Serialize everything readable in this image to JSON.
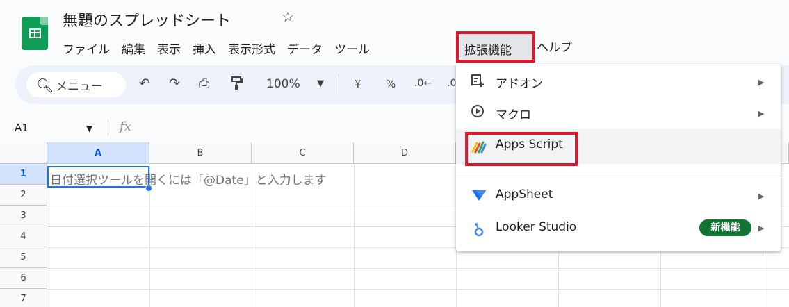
{
  "header": {
    "doc_title": "無題のスプレッドシート",
    "star": "☆"
  },
  "menubar": {
    "items": [
      "ファイル",
      "編集",
      "表示",
      "挿入",
      "表示形式",
      "データ",
      "ツール"
    ],
    "active": "拡張機能",
    "help": "ヘルプ"
  },
  "toolbar": {
    "search_label": "メニュー",
    "undo": "↶",
    "redo": "↷",
    "print": "⎙",
    "paint": "🖌",
    "zoom": "100%",
    "currency": "¥",
    "percent": "%",
    "decimal": ".0←",
    "decimal_more": ".0"
  },
  "formula_bar": {
    "name_box": "A1",
    "fx": "fx"
  },
  "grid": {
    "columns": [
      "A",
      "B",
      "C",
      "D"
    ],
    "rows": [
      "1",
      "2",
      "3",
      "4",
      "5",
      "6",
      "7"
    ],
    "cell_a1_hint": "日付選択ツールを開くには「@Date」と入力します"
  },
  "dropdown": {
    "items": [
      {
        "label": "アドオン",
        "icon": "addon-icon",
        "submenu": true
      },
      {
        "label": "マクロ",
        "icon": "macro-icon",
        "submenu": true
      },
      {
        "label": "Apps Script",
        "icon": "apps-script-icon",
        "submenu": false
      },
      {
        "label": "AppSheet",
        "icon": "appsheet-icon",
        "submenu": true
      },
      {
        "label": "Looker Studio",
        "icon": "looker-studio-icon",
        "submenu": true
      }
    ],
    "badge": "新機能",
    "arrow": "▶"
  },
  "colors": {
    "highlight_red": "#e0182d",
    "sheets_green": "#0f9d58",
    "selection_blue": "#1a73e8",
    "badge_green": "#137333"
  }
}
